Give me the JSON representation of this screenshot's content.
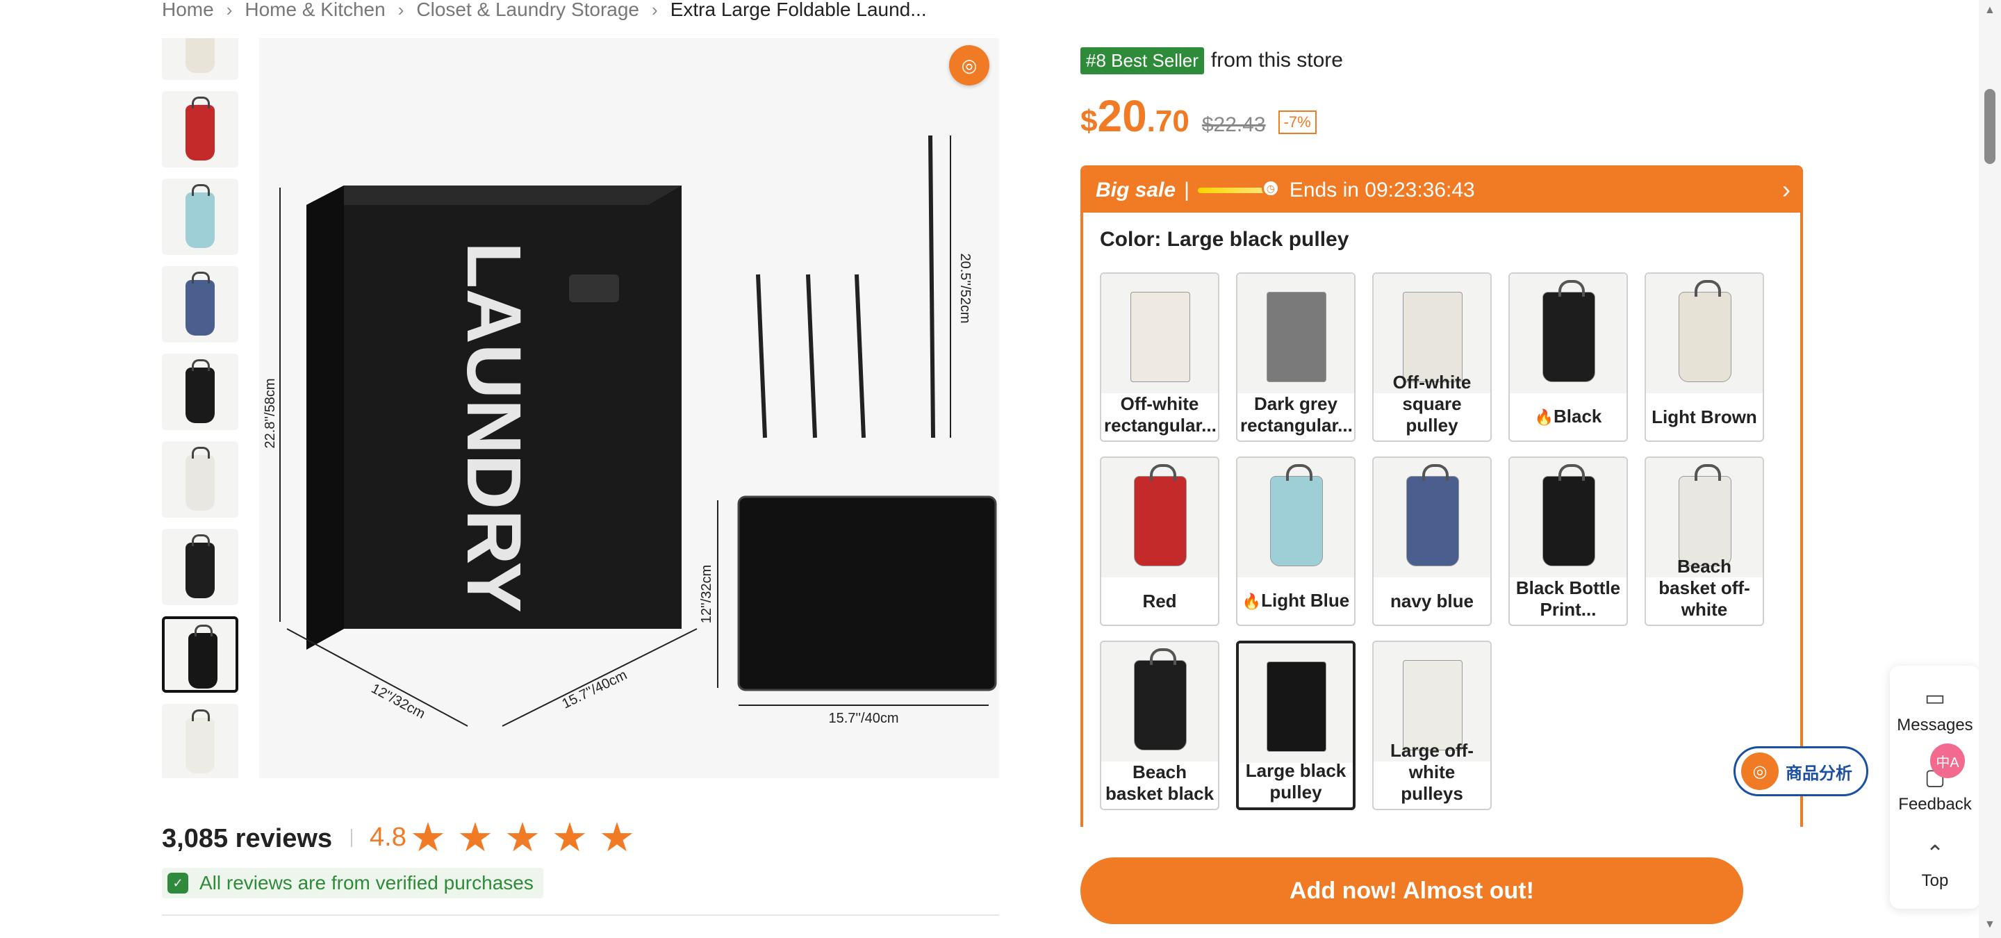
{
  "breadcrumb": {
    "items": [
      "Home",
      "Home & Kitchen",
      "Closet & Laundry Storage",
      "Extra Large Foldable Laund..."
    ],
    "separator": "›"
  },
  "gallery": {
    "product_print": "LAUNDRY",
    "dimensions": {
      "height": "22.8''/58cm",
      "width": "12''/32cm",
      "depth": "15.7''/40cm",
      "rod": "20.5''/52cm",
      "base_height": "12''/32cm",
      "base_width": "15.7''/40cm"
    },
    "analysis_icon": "analysis-icon"
  },
  "reviews": {
    "count_text": "3,085 reviews",
    "rating": "4.8",
    "stars": 5,
    "verified_text": "All reviews are from verified purchases"
  },
  "product": {
    "bestseller_badge": "#8 Best Seller",
    "bestseller_suffix": "from this store",
    "price_currency": "$",
    "price_int": "20",
    "price_dec": ".70",
    "price_old": "$22.43",
    "discount": "-7%"
  },
  "sale": {
    "title": "Big sale",
    "pipe": "|",
    "ends_text": "Ends in 09:23:36:43",
    "chevron": "›"
  },
  "color": {
    "label": "Color: Large black pulley",
    "options": [
      {
        "label": "Off-white rectangular...",
        "color": "#eeeae2",
        "box": true,
        "hot": false
      },
      {
        "label": "Dark grey rectangular...",
        "color": "#7a7a7a",
        "box": true,
        "hot": false
      },
      {
        "label": "Off-white square pulley",
        "color": "#e8e5de",
        "box": true,
        "hot": false
      },
      {
        "label": "Black",
        "color": "#1d1d1d",
        "box": false,
        "hot": true
      },
      {
        "label": "Light Brown",
        "color": "#e7e2d6",
        "box": false,
        "hot": false
      },
      {
        "label": "Red",
        "color": "#c52a2a",
        "box": false,
        "hot": false
      },
      {
        "label": "Light Blue",
        "color": "#9fcfd6",
        "box": false,
        "hot": true
      },
      {
        "label": "navy blue",
        "color": "#4a5f8d",
        "box": false,
        "hot": false
      },
      {
        "label": "Black Bottle Print...",
        "color": "#1a1a1a",
        "box": false,
        "hot": false
      },
      {
        "label": "Beach basket off-white",
        "color": "#e9e7e1",
        "box": false,
        "hot": false
      },
      {
        "label": "Beach basket black",
        "color": "#1e1e1e",
        "box": false,
        "hot": false
      },
      {
        "label": "Large black pulley",
        "color": "#161616",
        "box": true,
        "hot": false
      },
      {
        "label": "Large off-white pulleys",
        "color": "#ecebe6",
        "box": true,
        "hot": false
      }
    ],
    "selected_index": 11
  },
  "cta": {
    "add_label": "Add now! Almost out!"
  },
  "floating": {
    "analysis_label": "商品分析",
    "messages_label": "Messages",
    "feedback_label": "Feedback",
    "top_label": "Top",
    "translate_glyph": "中A"
  },
  "thumbs": [
    {
      "color": "#e8e4d8",
      "selected": false
    },
    {
      "color": "#c52a2a",
      "selected": false
    },
    {
      "color": "#9fcfd6",
      "selected": false
    },
    {
      "color": "#4a5f8d",
      "selected": false
    },
    {
      "color": "#1a1a1a",
      "selected": false
    },
    {
      "color": "#e9e7e1",
      "selected": false
    },
    {
      "color": "#1e1e1e",
      "selected": false
    },
    {
      "color": "#161616",
      "selected": true
    },
    {
      "color": "#ecebe6",
      "selected": false
    }
  ],
  "colors": {
    "accent": "#f07b24",
    "green": "#2e8b3a",
    "navy": "#1b4fa3"
  }
}
